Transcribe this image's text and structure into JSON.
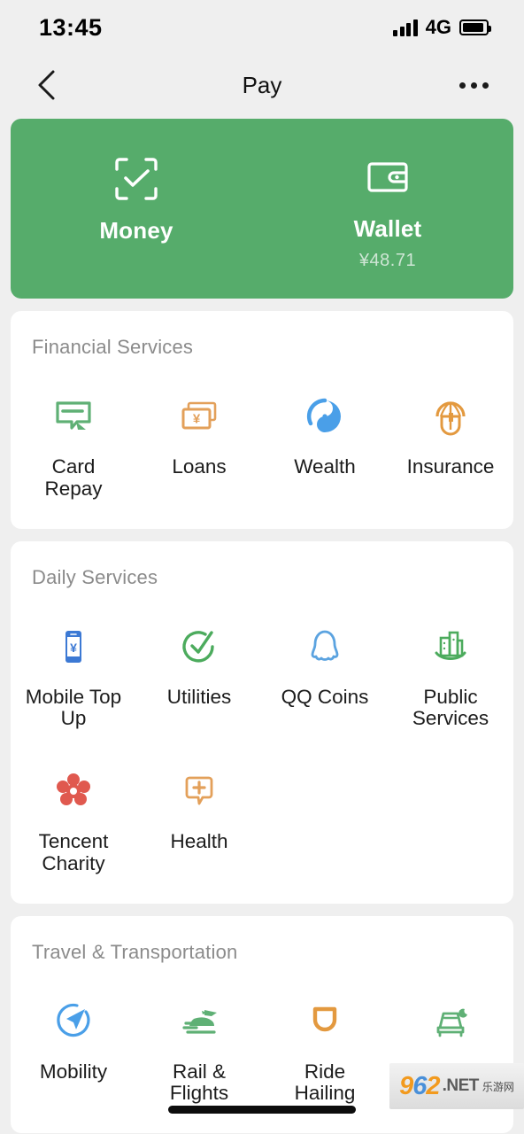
{
  "status_bar": {
    "time": "13:45",
    "network": "4G",
    "signal_icon": "signal-bars-icon",
    "battery_icon": "battery-icon"
  },
  "header": {
    "title": "Pay",
    "back_icon": "chevron-left-icon",
    "more_icon": "more-horizontal-icon"
  },
  "quick_actions": [
    {
      "label": "Money",
      "sub": "",
      "icon": "scan-check-icon"
    },
    {
      "label": "Wallet",
      "sub": "¥48.71",
      "icon": "wallet-icon"
    }
  ],
  "sections": [
    {
      "title": "Financial Services",
      "items": [
        {
          "label": "Card Repay",
          "icon": "credit-card-repay-icon",
          "color": "#5fb075"
        },
        {
          "label": "Loans",
          "icon": "banknotes-yuan-icon",
          "color": "#e3a05a"
        },
        {
          "label": "Wealth",
          "icon": "wealth-refresh-icon",
          "color": "#4a9fe8"
        },
        {
          "label": "Insurance",
          "icon": "insurance-umbrella-icon",
          "color": "#e3993f"
        }
      ]
    },
    {
      "title": "Daily Services",
      "items": [
        {
          "label": "Mobile Top Up",
          "icon": "phone-yuan-icon",
          "color": "#3c79d4"
        },
        {
          "label": "Utilities",
          "icon": "check-circle-icon",
          "color": "#4cab5d"
        },
        {
          "label": "QQ Coins",
          "icon": "qq-penguin-icon",
          "color": "#5ba3e0"
        },
        {
          "label": "Public Services",
          "icon": "city-buildings-icon",
          "color": "#4cab5d"
        },
        {
          "label": "Tencent Charity",
          "icon": "flower-icon",
          "color": "#e0594f"
        },
        {
          "label": "Health",
          "icon": "health-bubble-icon",
          "color": "#e3a05a"
        }
      ]
    },
    {
      "title": "Travel & Transportation",
      "items": [
        {
          "label": "Mobility",
          "icon": "compass-navigation-icon",
          "color": "#4a9fe8"
        },
        {
          "label": "Rail & Flights",
          "icon": "train-plane-icon",
          "color": "#5fb075"
        },
        {
          "label": "Ride Hailing",
          "icon": "didi-d-icon",
          "color": "#e3993f"
        },
        {
          "label": "Hotels",
          "icon": "bed-moon-icon",
          "color": "#5fb075"
        }
      ]
    }
  ],
  "watermark": {
    "brand": "962",
    "tld": ".NET",
    "cn": "乐游网"
  },
  "theme": {
    "accent_green": "#56ac6b",
    "page_bg": "#efefef",
    "card_bg": "#ffffff"
  }
}
